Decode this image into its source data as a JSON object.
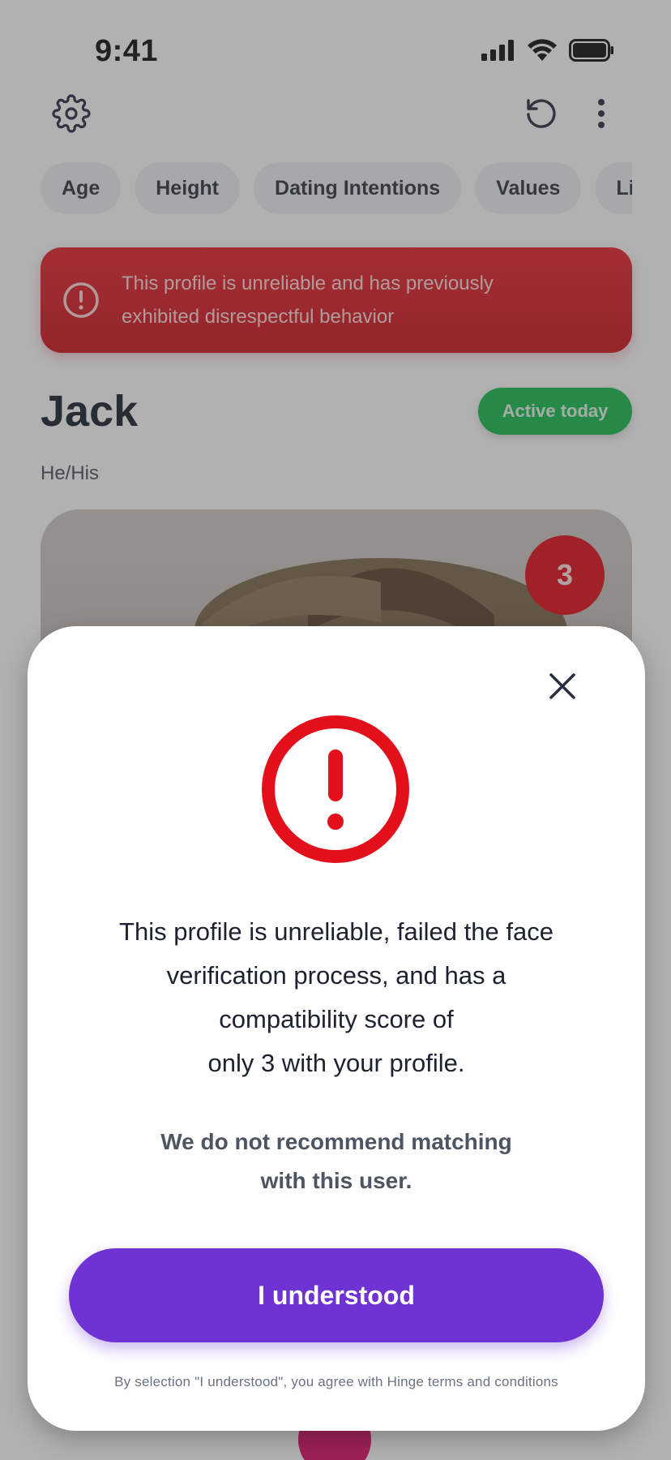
{
  "status_bar": {
    "time": "9:41"
  },
  "filters": [
    "Age",
    "Height",
    "Dating Intentions",
    "Values",
    "Lifestyle"
  ],
  "warning_banner": {
    "text": "This profile is unreliable and has previously exhibited disrespectful behavior"
  },
  "profile": {
    "name": "Jack",
    "status": "Active today",
    "pronouns": "He/His",
    "compatibility_score": "3"
  },
  "modal": {
    "message_lines": [
      "This profile is unreliable, failed the face",
      "verification process, and has a",
      "compatibility score of",
      "only 3 with your profile."
    ],
    "recommend_lines": [
      "We do not recommend matching",
      "with this user."
    ],
    "button_label": "I understood",
    "legal_text": "By selection \"I understood\", you agree with Hinge terms and conditions"
  },
  "colors": {
    "banner": "#d21a24",
    "active": "#19bd50",
    "alert": "#e3101c",
    "primary": "#6f33d3"
  }
}
